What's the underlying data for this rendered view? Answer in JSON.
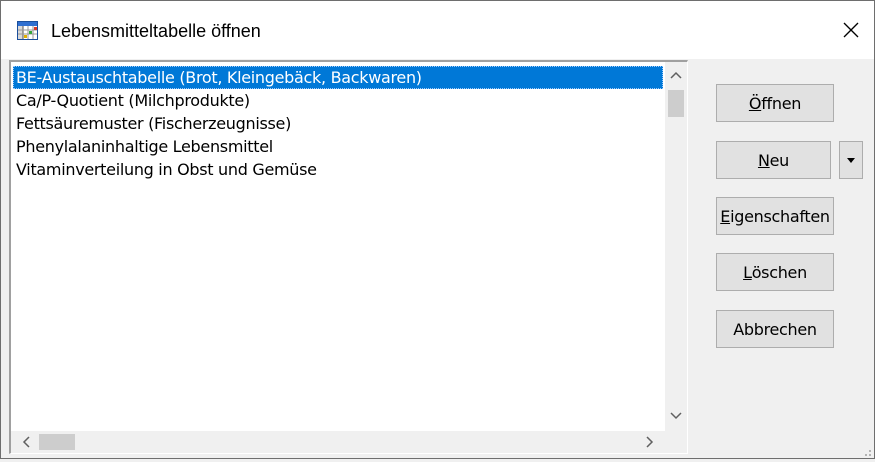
{
  "window": {
    "title": "Lebensmitteltabelle öffnen",
    "icon": "table-app-icon",
    "close_icon": "close-icon"
  },
  "list": {
    "items": [
      {
        "label": "BE-Austauschtabelle (Brot, Kleingebäck, Backwaren)",
        "selected": true
      },
      {
        "label": "Ca/P-Quotient (Milchprodukte)",
        "selected": false
      },
      {
        "label": "Fettsäuremuster (Fischerzeugnisse)",
        "selected": false
      },
      {
        "label": "Phenylalaninhaltige Lebensmittel",
        "selected": false
      },
      {
        "label": "Vitaminverteilung in Obst und Gemüse",
        "selected": false
      }
    ],
    "selection_color": "#0078d7"
  },
  "buttons": {
    "open": {
      "accel": "Ö",
      "rest": "ffnen"
    },
    "new": {
      "accel": "N",
      "rest": "eu"
    },
    "new_dropdown_icon": "triangle-down-icon",
    "properties": {
      "accel": "E",
      "rest": "igenschaften"
    },
    "delete": {
      "accel": "L",
      "rest": "öschen"
    },
    "cancel": {
      "label": "Abbrechen"
    }
  }
}
